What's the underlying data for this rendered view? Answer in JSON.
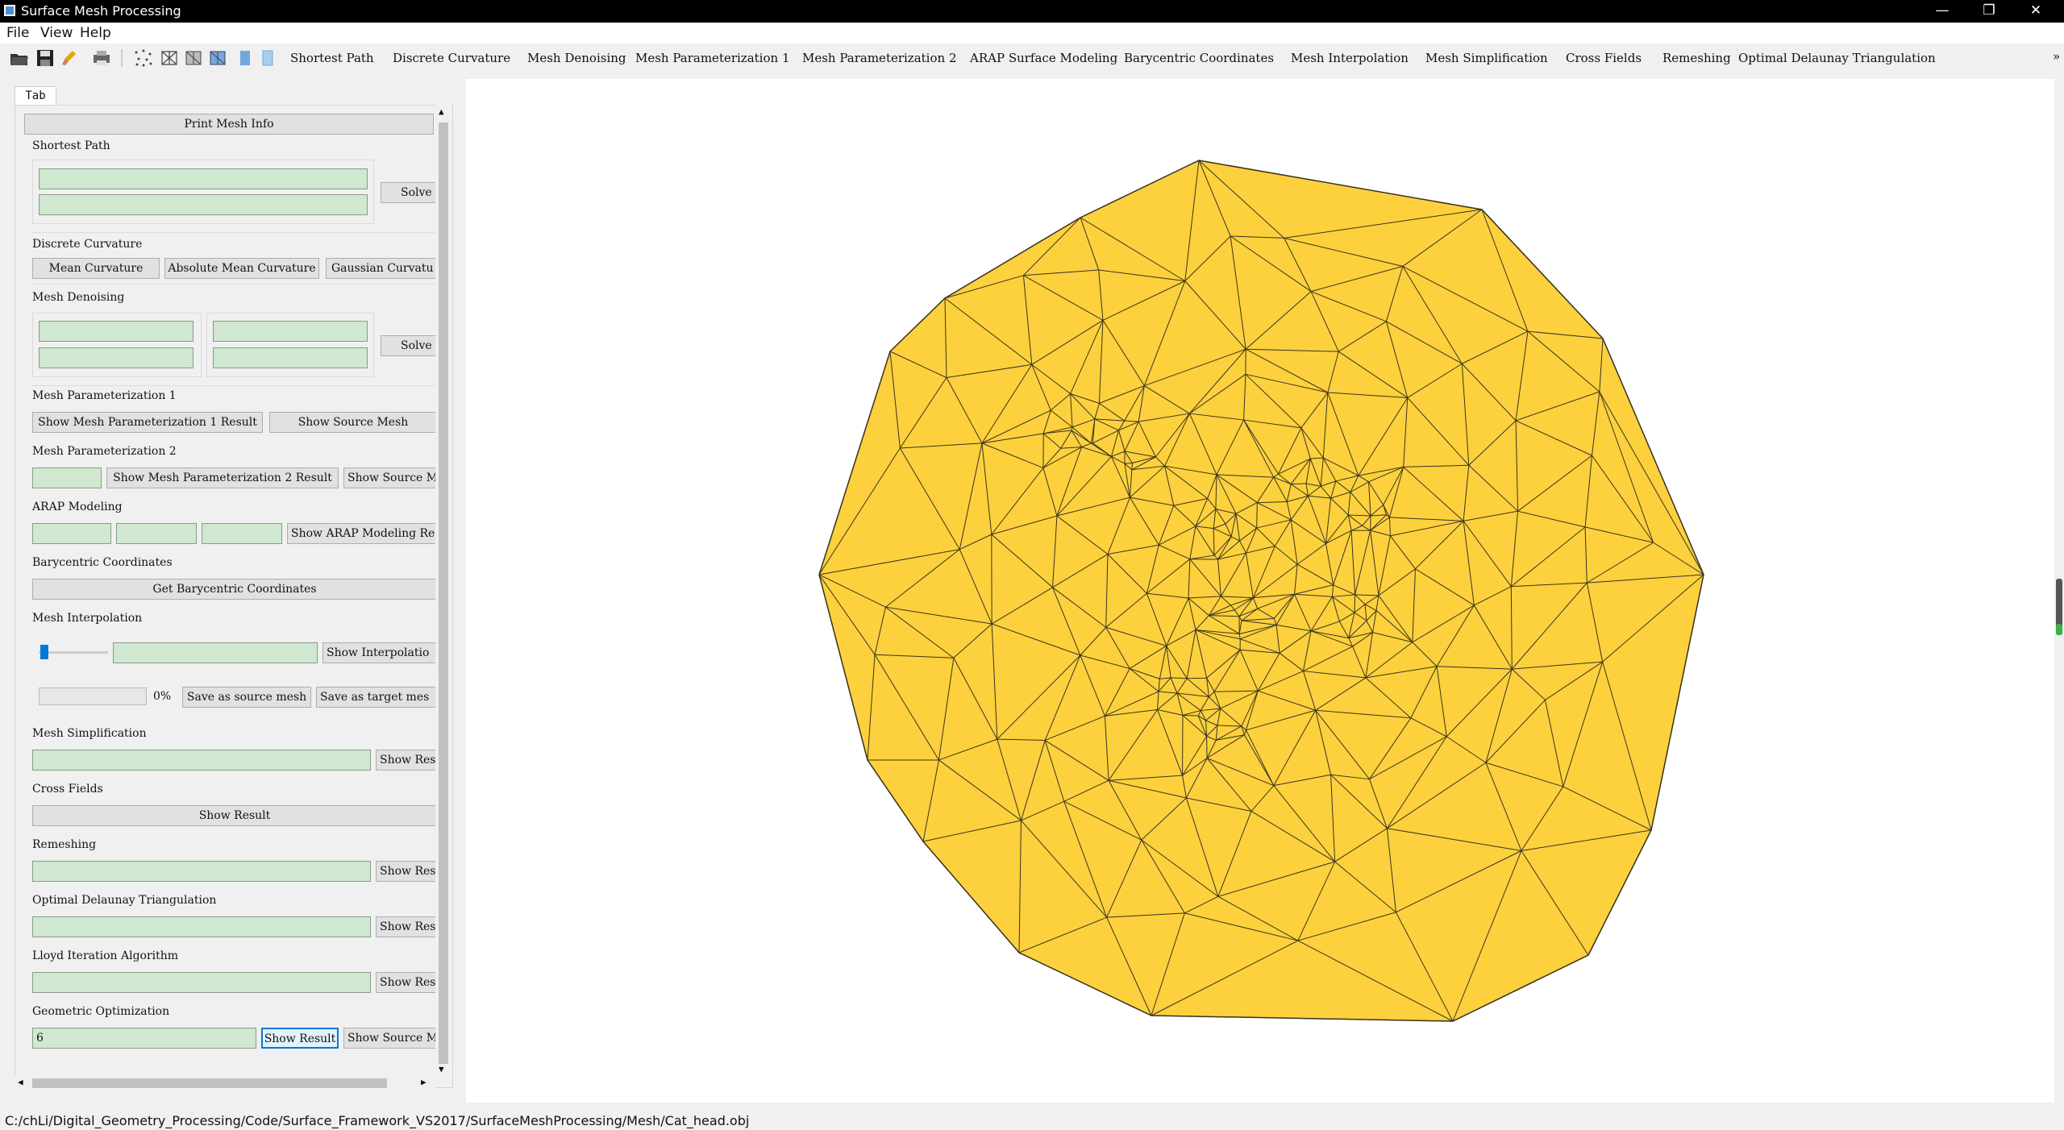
{
  "window": {
    "title": "Surface Mesh Processing",
    "minimize": "—",
    "restore": "❐",
    "close": "✕"
  },
  "menu": {
    "file": "File",
    "view": "View",
    "help": "Help"
  },
  "toolbar": {
    "tabs": [
      "Shortest Path",
      "Discrete Curvature",
      "Mesh Denoising",
      "Mesh Parameterization 1",
      "Mesh Parameterization 2",
      "ARAP Surface Modeling",
      "Barycentric Coordinates",
      "Mesh Interpolation",
      "Mesh Simplification",
      "Cross Fields",
      "Remeshing",
      "Optimal Delaunay Triangulation"
    ],
    "overflow": "»",
    "icons": [
      "open-folder-icon",
      "save-icon",
      "clear-icon",
      "print-icon",
      "points-icon",
      "wireframe-icon",
      "flat-icon",
      "smooth-icon",
      "color-icon",
      "texture-icon"
    ]
  },
  "panel": {
    "tab_label": "Tab",
    "print_mesh_info": "Print Mesh Info",
    "shortest_path": {
      "title": "Shortest Path",
      "solve": "Solve"
    },
    "discrete_curvature": {
      "title": "Discrete Curvature",
      "mean": "Mean Curvature",
      "abs_mean": "Absolute Mean Curvature",
      "gaussian": "Gaussian Curvatu"
    },
    "mesh_denoising": {
      "title": "Mesh Denoising",
      "solve": "Solve"
    },
    "param1": {
      "title": "Mesh Parameterization 1",
      "show_result": "Show Mesh Parameterization 1 Result",
      "show_source": "Show Source Mesh"
    },
    "param2": {
      "title": "Mesh Parameterization 2",
      "show_result": "Show Mesh Parameterization 2 Result",
      "show_source": "Show Source Me"
    },
    "arap": {
      "title": "ARAP Modeling",
      "show_result": "Show ARAP Modeling Resu"
    },
    "barycentric": {
      "title": "Barycentric Coordinates",
      "get": "Get Barycentric Coordinates"
    },
    "interpolation": {
      "title": "Mesh Interpolation",
      "show": "Show Interpolatio",
      "percent": "0%",
      "save_source": "Save as source mesh",
      "save_target": "Save as target mes"
    },
    "simplification": {
      "title": "Mesh Simplification",
      "show": "Show Resu"
    },
    "cross_fields": {
      "title": "Cross Fields",
      "show": "Show Result"
    },
    "remeshing": {
      "title": "Remeshing",
      "show": "Show Resu"
    },
    "odt": {
      "title": "Optimal Delaunay Triangulation",
      "show": "Show Resu"
    },
    "lloyd": {
      "title": "Lloyd Iteration Algorithm",
      "show": "Show Resu"
    },
    "geo_opt": {
      "title": "Geometric Optimization",
      "value": "6",
      "show_result": "Show Result",
      "show_source": "Show Source Me"
    }
  },
  "viewport": {
    "mesh_fill": "#FDD13D",
    "edge_color": "#3a3320"
  },
  "status": {
    "path": "C:/chLi/Digital_Geometry_Processing/Code/Surface_Framework_VS2017/SurfaceMeshProcessing/Mesh/Cat_head.obj"
  }
}
